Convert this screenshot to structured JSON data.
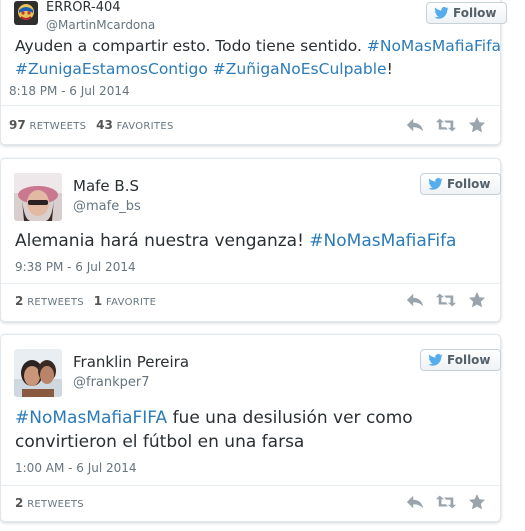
{
  "colors": {
    "link": "#2b7bb9",
    "twitter_blue": "#55acee",
    "icon_gray": "#9aa4ac"
  },
  "tweets": [
    {
      "display_name": "ERROR-404",
      "handle": "@MartinMcardona",
      "follow_label": "Follow",
      "text_line1": {
        "plain": "Ayuden a compartir esto. Todo tiene sentido.",
        "hashtag": "#NoMasMafiaFifa"
      },
      "text_line2": {
        "hashtag1": "#ZunigaEstamosContigo",
        "hashtag2": "#ZuñigaNoEsCulpable",
        "suffix": "!"
      },
      "timestamp": "8:18 PM - 6 Jul 2014",
      "retweets_count": "97",
      "retweets_label": "RETWEETS",
      "favorites_count": "43",
      "favorites_label": "FAVORITES",
      "actions": [
        "reply-icon",
        "retweet-icon",
        "favorite-icon"
      ]
    },
    {
      "display_name": "Mafe B.S",
      "handle": "@mafe_bs",
      "follow_label": "Follow",
      "text_line1": {
        "plain": "Alemania hará nuestra venganza!",
        "hashtag": "#NoMasMafiaFifa"
      },
      "timestamp": "9:38 PM - 6 Jul 2014",
      "retweets_count": "2",
      "retweets_label": "RETWEETS",
      "favorites_count": "1",
      "favorites_label": "FAVORITE",
      "actions": [
        "reply-icon",
        "retweet-icon",
        "favorite-icon"
      ]
    },
    {
      "display_name": "Franklin Pereira",
      "handle": "@frankper7",
      "follow_label": "Follow",
      "text_line1": {
        "hashtag": "#NoMasMafiaFIFA",
        "plain": "fue una desilusión ver como"
      },
      "text_line2": {
        "plain": "convirtieron el fútbol en una farsa"
      },
      "timestamp": "1:00 AM - 6 Jul 2014",
      "retweets_count": "2",
      "retweets_label": "RETWEETS",
      "actions": [
        "reply-icon",
        "retweet-icon",
        "favorite-icon"
      ]
    }
  ]
}
